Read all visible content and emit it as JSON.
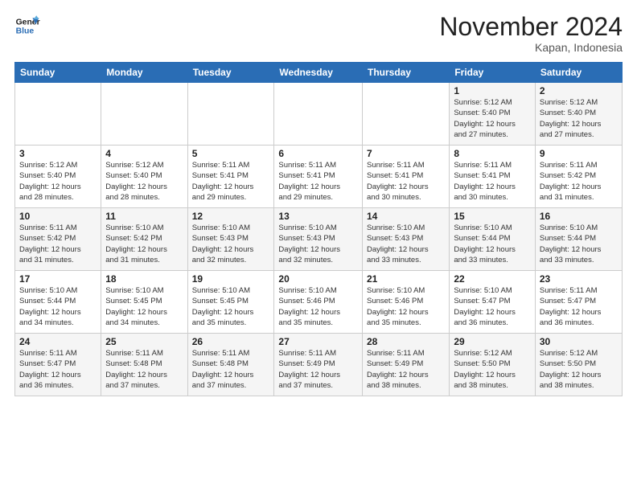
{
  "header": {
    "logo_line1": "General",
    "logo_line2": "Blue",
    "month": "November 2024",
    "location": "Kapan, Indonesia"
  },
  "weekdays": [
    "Sunday",
    "Monday",
    "Tuesday",
    "Wednesday",
    "Thursday",
    "Friday",
    "Saturday"
  ],
  "weeks": [
    [
      {
        "day": "",
        "info": ""
      },
      {
        "day": "",
        "info": ""
      },
      {
        "day": "",
        "info": ""
      },
      {
        "day": "",
        "info": ""
      },
      {
        "day": "",
        "info": ""
      },
      {
        "day": "1",
        "info": "Sunrise: 5:12 AM\nSunset: 5:40 PM\nDaylight: 12 hours\nand 27 minutes."
      },
      {
        "day": "2",
        "info": "Sunrise: 5:12 AM\nSunset: 5:40 PM\nDaylight: 12 hours\nand 27 minutes."
      }
    ],
    [
      {
        "day": "3",
        "info": "Sunrise: 5:12 AM\nSunset: 5:40 PM\nDaylight: 12 hours\nand 28 minutes."
      },
      {
        "day": "4",
        "info": "Sunrise: 5:12 AM\nSunset: 5:40 PM\nDaylight: 12 hours\nand 28 minutes."
      },
      {
        "day": "5",
        "info": "Sunrise: 5:11 AM\nSunset: 5:41 PM\nDaylight: 12 hours\nand 29 minutes."
      },
      {
        "day": "6",
        "info": "Sunrise: 5:11 AM\nSunset: 5:41 PM\nDaylight: 12 hours\nand 29 minutes."
      },
      {
        "day": "7",
        "info": "Sunrise: 5:11 AM\nSunset: 5:41 PM\nDaylight: 12 hours\nand 30 minutes."
      },
      {
        "day": "8",
        "info": "Sunrise: 5:11 AM\nSunset: 5:41 PM\nDaylight: 12 hours\nand 30 minutes."
      },
      {
        "day": "9",
        "info": "Sunrise: 5:11 AM\nSunset: 5:42 PM\nDaylight: 12 hours\nand 31 minutes."
      }
    ],
    [
      {
        "day": "10",
        "info": "Sunrise: 5:11 AM\nSunset: 5:42 PM\nDaylight: 12 hours\nand 31 minutes."
      },
      {
        "day": "11",
        "info": "Sunrise: 5:10 AM\nSunset: 5:42 PM\nDaylight: 12 hours\nand 31 minutes."
      },
      {
        "day": "12",
        "info": "Sunrise: 5:10 AM\nSunset: 5:43 PM\nDaylight: 12 hours\nand 32 minutes."
      },
      {
        "day": "13",
        "info": "Sunrise: 5:10 AM\nSunset: 5:43 PM\nDaylight: 12 hours\nand 32 minutes."
      },
      {
        "day": "14",
        "info": "Sunrise: 5:10 AM\nSunset: 5:43 PM\nDaylight: 12 hours\nand 33 minutes."
      },
      {
        "day": "15",
        "info": "Sunrise: 5:10 AM\nSunset: 5:44 PM\nDaylight: 12 hours\nand 33 minutes."
      },
      {
        "day": "16",
        "info": "Sunrise: 5:10 AM\nSunset: 5:44 PM\nDaylight: 12 hours\nand 33 minutes."
      }
    ],
    [
      {
        "day": "17",
        "info": "Sunrise: 5:10 AM\nSunset: 5:44 PM\nDaylight: 12 hours\nand 34 minutes."
      },
      {
        "day": "18",
        "info": "Sunrise: 5:10 AM\nSunset: 5:45 PM\nDaylight: 12 hours\nand 34 minutes."
      },
      {
        "day": "19",
        "info": "Sunrise: 5:10 AM\nSunset: 5:45 PM\nDaylight: 12 hours\nand 35 minutes."
      },
      {
        "day": "20",
        "info": "Sunrise: 5:10 AM\nSunset: 5:46 PM\nDaylight: 12 hours\nand 35 minutes."
      },
      {
        "day": "21",
        "info": "Sunrise: 5:10 AM\nSunset: 5:46 PM\nDaylight: 12 hours\nand 35 minutes."
      },
      {
        "day": "22",
        "info": "Sunrise: 5:10 AM\nSunset: 5:47 PM\nDaylight: 12 hours\nand 36 minutes."
      },
      {
        "day": "23",
        "info": "Sunrise: 5:11 AM\nSunset: 5:47 PM\nDaylight: 12 hours\nand 36 minutes."
      }
    ],
    [
      {
        "day": "24",
        "info": "Sunrise: 5:11 AM\nSunset: 5:47 PM\nDaylight: 12 hours\nand 36 minutes."
      },
      {
        "day": "25",
        "info": "Sunrise: 5:11 AM\nSunset: 5:48 PM\nDaylight: 12 hours\nand 37 minutes."
      },
      {
        "day": "26",
        "info": "Sunrise: 5:11 AM\nSunset: 5:48 PM\nDaylight: 12 hours\nand 37 minutes."
      },
      {
        "day": "27",
        "info": "Sunrise: 5:11 AM\nSunset: 5:49 PM\nDaylight: 12 hours\nand 37 minutes."
      },
      {
        "day": "28",
        "info": "Sunrise: 5:11 AM\nSunset: 5:49 PM\nDaylight: 12 hours\nand 38 minutes."
      },
      {
        "day": "29",
        "info": "Sunrise: 5:12 AM\nSunset: 5:50 PM\nDaylight: 12 hours\nand 38 minutes."
      },
      {
        "day": "30",
        "info": "Sunrise: 5:12 AM\nSunset: 5:50 PM\nDaylight: 12 hours\nand 38 minutes."
      }
    ]
  ]
}
